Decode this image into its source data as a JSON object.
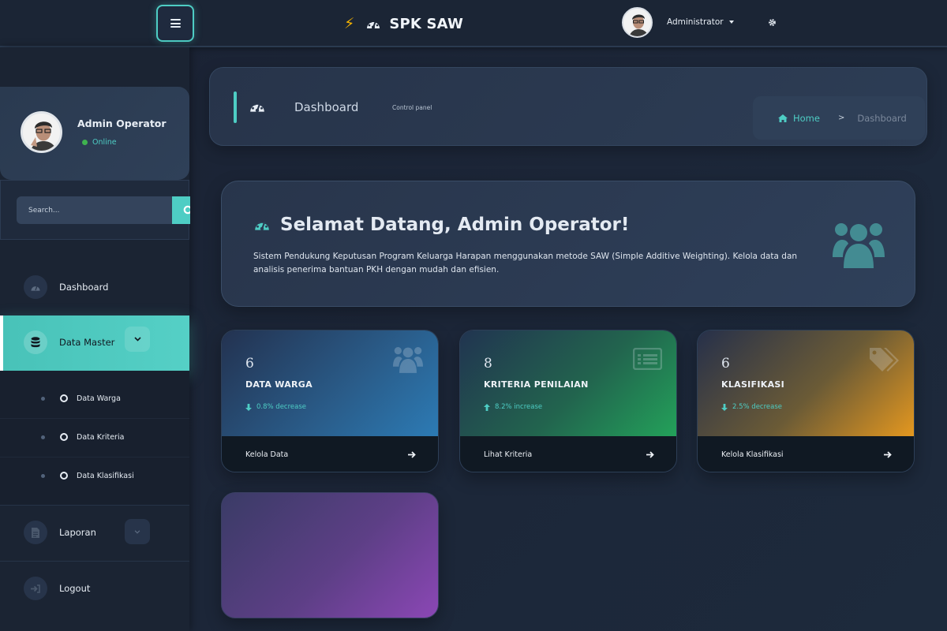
{
  "header": {
    "brand": "SPK SAW",
    "user": "Administrator"
  },
  "sidebar": {
    "user_name": "Admin Operator",
    "user_status": "Online",
    "search_placeholder": "Search...",
    "items": [
      {
        "label": "Dashboard",
        "icon": "gauge-icon"
      },
      {
        "label": "Data Master",
        "icon": "database-icon"
      },
      {
        "label": "Laporan",
        "icon": "file-icon"
      },
      {
        "label": "Logout",
        "icon": "logout-icon"
      }
    ],
    "submenu": [
      {
        "label": "Data Warga"
      },
      {
        "label": "Data Kriteria"
      },
      {
        "label": "Data Klasifikasi"
      }
    ]
  },
  "content_header": {
    "title": "Dashboard",
    "subtitle": "Control panel",
    "breadcrumb_home": "Home",
    "breadcrumb_sep": ">",
    "breadcrumb_current": "Dashboard"
  },
  "welcome": {
    "title": "Selamat Datang, Admin Operator!",
    "description": "Sistem Pendukung Keputusan Program Keluarga Harapan menggunakan metode SAW (Simple Additive Weighting). Kelola data dan analisis penerima bantuan PKH dengan mudah dan efisien."
  },
  "stats": [
    {
      "value": "6",
      "label": "DATA WARGA",
      "trend": "0.8% decrease",
      "trend_dir": "down",
      "link": "Kelola Data",
      "icon": "users-icon",
      "color": "#2c7bb5"
    },
    {
      "value": "8",
      "label": "KRITERIA PENILAIAN",
      "trend": "8.2% increase",
      "trend_dir": "up",
      "link": "Lihat Kriteria",
      "icon": "list-icon",
      "color": "#23a25a"
    },
    {
      "value": "6",
      "label": "KLASIFIKASI",
      "trend": "2.5% decrease",
      "trend_dir": "down",
      "link": "Kelola Klasifikasi",
      "icon": "tags-icon",
      "color": "#e5981f"
    }
  ],
  "colors": {
    "accent": "#4ecdc4",
    "brand_bolt": "#f5b301",
    "online": "#3fb34f"
  }
}
